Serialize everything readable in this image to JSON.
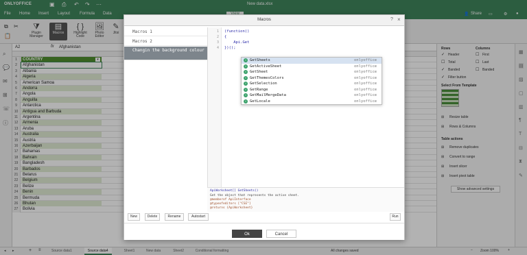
{
  "app": {
    "logo": "ONLYOFFICE",
    "doc_title": "New data.xlsx",
    "share_label": "Share"
  },
  "menu": {
    "items": [
      "File",
      "Home",
      "Insert",
      "Layout",
      "Formula",
      "Data"
    ],
    "active_tab": "View"
  },
  "toolbar": {
    "buttons": [
      {
        "label": "Plugin Manager",
        "icon": "puzzle-icon"
      },
      {
        "label": "Macros",
        "icon": "macros-icon"
      },
      {
        "label": "Highlight Code",
        "icon": "braces-icon"
      },
      {
        "label": "Photo Editor",
        "icon": "photo-icon"
      },
      {
        "label": "Jitsi",
        "icon": "camera-icon"
      }
    ]
  },
  "formula_bar": {
    "cell_ref": "A2",
    "fx": "fx",
    "value": "Afghanistan"
  },
  "sheet": {
    "header": "COUNTRY",
    "rows": [
      {
        "n": "1",
        "v": "COUNTRY"
      },
      {
        "n": "2",
        "v": "Afghanistan"
      },
      {
        "n": "3",
        "v": "Albania"
      },
      {
        "n": "4",
        "v": "Algeria"
      },
      {
        "n": "5",
        "v": "American Samoa"
      },
      {
        "n": "6",
        "v": "Andorra"
      },
      {
        "n": "7",
        "v": "Angola"
      },
      {
        "n": "8",
        "v": "Anguilla"
      },
      {
        "n": "9",
        "v": "Antarctica"
      },
      {
        "n": "10",
        "v": "Antigua and Barbuda"
      },
      {
        "n": "11",
        "v": "Argentina"
      },
      {
        "n": "12",
        "v": "Armenia"
      },
      {
        "n": "13",
        "v": "Aruba"
      },
      {
        "n": "14",
        "v": "Australia"
      },
      {
        "n": "15",
        "v": "Austria"
      },
      {
        "n": "16",
        "v": "Azerbaijan"
      },
      {
        "n": "17",
        "v": "Bahamas"
      },
      {
        "n": "18",
        "v": "Bahrain"
      },
      {
        "n": "19",
        "v": "Bangladesh"
      },
      {
        "n": "20",
        "v": "Barbados"
      },
      {
        "n": "21",
        "v": "Belarus"
      },
      {
        "n": "22",
        "v": "Belgium"
      },
      {
        "n": "23",
        "v": "Belize"
      },
      {
        "n": "24",
        "v": "Benin"
      },
      {
        "n": "25",
        "v": "Bermuda"
      },
      {
        "n": "26",
        "v": "Bhutan"
      },
      {
        "n": "27",
        "v": "Bolivia"
      }
    ]
  },
  "right_panel": {
    "rows_title": "Rows",
    "columns_title": "Columns",
    "rows_opts": [
      {
        "label": "Header",
        "checked": true
      },
      {
        "label": "Total",
        "checked": false
      },
      {
        "label": "Banded",
        "checked": true
      },
      {
        "label": "Filter button",
        "checked": true
      }
    ],
    "cols_opts": [
      {
        "label": "First",
        "checked": false
      },
      {
        "label": "Last",
        "checked": false
      },
      {
        "label": "Banded",
        "checked": false
      }
    ],
    "template_title": "Select From Template",
    "resize": "Resize table",
    "rows_cols": "Rows & Columns",
    "actions_title": "Table actions",
    "actions": [
      "Remove duplicates",
      "Convert to range",
      "Insert slicer",
      "Insert pivot table"
    ],
    "advanced": "Show advanced settings"
  },
  "status": {
    "tabs": [
      "Source data1",
      "Source data4",
      "Sheet1",
      "New data",
      "Sheet2",
      "Conditional formatting"
    ],
    "active_tab": "Source data4",
    "saved": "All changes saved",
    "zoom": "Zoom 100%"
  },
  "dialog": {
    "title": "Macros",
    "macros": [
      "Macros 1",
      "Macros 2",
      "Changin the background colour"
    ],
    "selected_index": 2,
    "code_lines": [
      {
        "n": "1",
        "t": "(function()"
      },
      {
        "n": "2",
        "t": "{"
      },
      {
        "n": "3",
        "t": "    Api.Get"
      },
      {
        "n": "4",
        "t": "})();"
      }
    ],
    "autocomplete": [
      {
        "name": "GetSheets",
        "scope": "onlyoffice"
      },
      {
        "name": "GetActiveSheet",
        "scope": "onlyoffice"
      },
      {
        "name": "GetSheet",
        "scope": "onlyoffice"
      },
      {
        "name": "GetThemesColors",
        "scope": "onlyoffice"
      },
      {
        "name": "GetSelection",
        "scope": "onlyoffice"
      },
      {
        "name": "GetRange",
        "scope": "onlyoffice"
      },
      {
        "name": "GetMailMergeData",
        "scope": "onlyoffice"
      },
      {
        "name": "GetLocale",
        "scope": "onlyoffice"
      }
    ],
    "help": {
      "signature": "ApiWorksheet[] GetSheets()",
      "desc": "Get the object that represents the active sheet.",
      "tags": [
        "@memberof ApiInterface",
        "@typeofeditors [\"CSE\"]",
        "@returns {ApiWorksheet}"
      ]
    },
    "buttons": {
      "new": "New",
      "delete": "Delete",
      "rename": "Rename",
      "autostart": "Autostart",
      "run": "Run",
      "ok": "Ok",
      "cancel": "Cancel"
    }
  },
  "colors": {
    "brand": "#40865c",
    "band": "#e1ecd4",
    "header_fill": "#4f8f2f"
  }
}
